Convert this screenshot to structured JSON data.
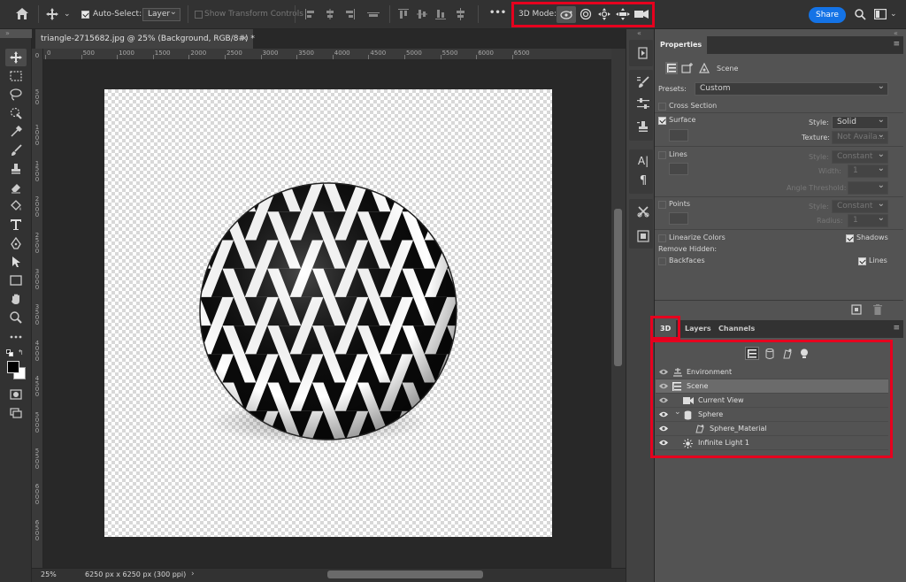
{
  "options_bar": {
    "auto_select_label": "Auto-Select:",
    "auto_select_value": "Layer",
    "show_transform_label": "Show Transform Controls",
    "more_label": "•••",
    "mode_label": "3D Mode:",
    "share_label": "Share"
  },
  "document": {
    "tab_title": "triangle-2715682.jpg @ 25% (Background, RGB/8#) *",
    "close_label": "×"
  },
  "ruler_top": [
    "0",
    "500",
    "1000",
    "1500",
    "2000",
    "2500",
    "3000",
    "3500",
    "4000",
    "4500",
    "5000",
    "5500",
    "6000",
    "6500"
  ],
  "ruler_left": [
    "0",
    "5\n0\n0",
    "1\n0\n0\n0",
    "1\n5\n0\n0",
    "2\n0\n0\n0",
    "2\n5\n0\n0",
    "3\n0\n0\n0",
    "3\n5\n0\n0",
    "4\n0\n0\n0",
    "4\n5\n0\n0",
    "5\n0\n0\n0",
    "5\n5\n0\n0",
    "6\n0\n0\n0",
    "6\n5\n0\n0"
  ],
  "status": {
    "zoom": "25%",
    "doc_size": "6250 px x 6250 px (300 ppi)",
    "arrow": "›"
  },
  "properties": {
    "title": "Properties",
    "scene_label": "Scene",
    "presets_label": "Presets:",
    "presets_value": "Custom",
    "cross_section": "Cross Section",
    "surface": "Surface",
    "surface_style_label": "Style:",
    "surface_style_value": "Solid",
    "texture_label": "Texture:",
    "texture_value": "Not Availa...",
    "lines": "Lines",
    "lines_style_label": "Style:",
    "lines_style_value": "Constant",
    "width_label": "Width:",
    "width_value": "1",
    "angle_label": "Angle Threshold:",
    "points": "Points",
    "points_style_label": "Style:",
    "points_style_value": "Constant",
    "radius_label": "Radius:",
    "radius_value": "1",
    "linearize": "Linearize Colors",
    "shadows": "Shadows",
    "remove_hidden": "Remove Hidden:",
    "backfaces": "Backfaces",
    "lines2": "Lines"
  },
  "panel_tabs": [
    "3D",
    "Layers",
    "Channels"
  ],
  "layers": [
    {
      "name": "Environment"
    },
    {
      "name": "Scene"
    },
    {
      "name": "Current View"
    },
    {
      "name": "Sphere",
      "expand": "⌄"
    },
    {
      "name": "Sphere_Material"
    },
    {
      "name": "Infinite Light 1"
    }
  ],
  "colors": {
    "accent": "#1473e6",
    "highlight": "#e6001e"
  }
}
